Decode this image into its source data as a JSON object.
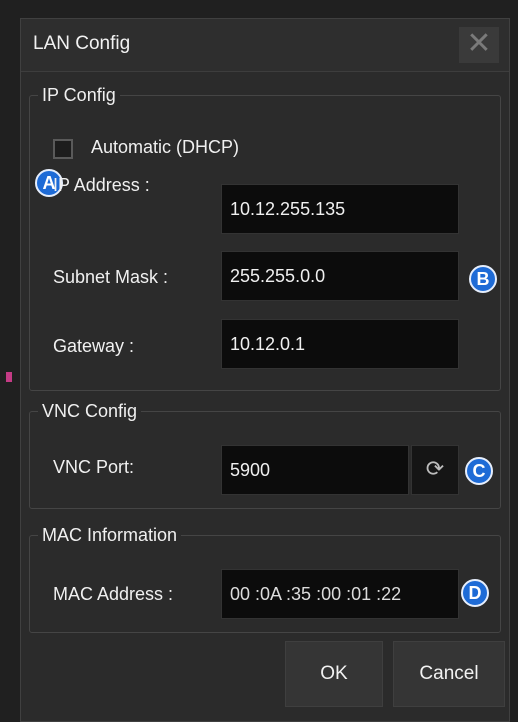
{
  "dialog": {
    "title": "LAN Config",
    "close_symbol": "✕"
  },
  "ip_config": {
    "legend": "IP Config",
    "dhcp_label": "Automatic (DHCP)",
    "dhcp_checked": false,
    "ip_address_label": "IP Address :",
    "ip_address_value": "10.12.255.135",
    "subnet_mask_label": "Subnet Mask :",
    "subnet_mask_value": "255.255.0.0",
    "gateway_label": "Gateway :",
    "gateway_value": "10.12.0.1"
  },
  "vnc_config": {
    "legend": "VNC Config",
    "port_label": "VNC Port:",
    "port_value": "5900",
    "refresh_icon": "refresh-icon"
  },
  "mac_info": {
    "legend": "MAC Information",
    "mac_label": "MAC Address :",
    "mac_value": "00 :0A :35 :00 :01 :22"
  },
  "buttons": {
    "ok": "OK",
    "cancel": "Cancel"
  },
  "callouts": {
    "a": "A",
    "b": "B",
    "c": "C",
    "d": "D"
  },
  "colors": {
    "callout": "#1e6bd6",
    "field_bg": "#0c0c0c",
    "dialog_bg": "#2b2b2b"
  }
}
